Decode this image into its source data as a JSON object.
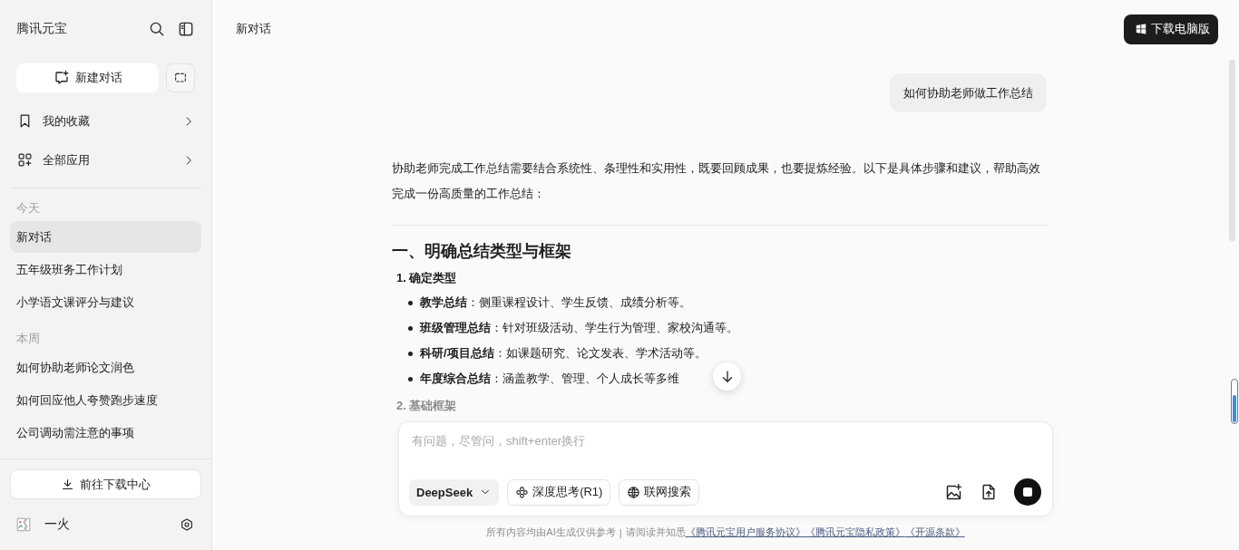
{
  "sidebar": {
    "app_title": "腾讯元宝",
    "new_chat_button": "新建对话",
    "menu": [
      {
        "label": "我的收藏",
        "kind": "bookmark"
      },
      {
        "label": "全部应用",
        "kind": "apps"
      }
    ],
    "sections": [
      {
        "heading": "今天",
        "items": [
          {
            "label": "新对话",
            "selected": true
          },
          {
            "label": "五年级班务工作计划",
            "selected": false
          },
          {
            "label": "小学语文课评分与建议",
            "selected": false
          }
        ]
      },
      {
        "heading": "本周",
        "items": [
          {
            "label": "如何协助老师论文润色",
            "selected": false
          },
          {
            "label": "如何回应他人夸赞跑步速度",
            "selected": false
          },
          {
            "label": "公司调动需注意的事项",
            "selected": false
          }
        ]
      }
    ],
    "download_center_button": "前往下载中心",
    "user": {
      "name": "一火"
    }
  },
  "header": {
    "title": "新对话",
    "download_button": "下载电脑版"
  },
  "chat": {
    "user_message": "如何协助老师做工作总结",
    "answer": {
      "intro": "协助老师完成工作总结需要结合系统性、条理性和实用性，既要回顾成果，也要提炼经验。以下是具体步骤和建议，帮助高效完成一份高质量的工作总结：",
      "heading": "一、明确总结类型与框架",
      "list": [
        {
          "number": "1.",
          "title": "确定类型",
          "bullets": [
            {
              "text": "**教学总结**：侧重课程设计、学生反馈、成绩分析等。"
            },
            {
              "text": "**班级管理总结**：针对班级活动、学生行为管理、家校沟通等。"
            },
            {
              "text": "**科研/项目总结**：如课题研究、论文发表、学术活动等。"
            },
            {
              "text": "**年度综合总结**：涵盖教学、管理、个人成长等多维"
            }
          ]
        },
        {
          "number": "2.",
          "title": "基础框架"
        }
      ]
    }
  },
  "composer": {
    "placeholder": "有问题，尽管问，shift+enter换行",
    "model": "DeepSeek",
    "toggles": [
      {
        "label": "深度思考(R1)",
        "kind": "think",
        "on": false
      },
      {
        "label": "联网搜索",
        "kind": "web",
        "on": false
      }
    ]
  },
  "footer": {
    "note": "所有内容均由AI生成仅供参考",
    "separator": "|",
    "prompt": "请阅读并知悉",
    "links": [
      "《腾讯元宝用户服务协议》",
      "《腾讯元宝隐私政策》",
      "《开源条款》"
    ]
  }
}
